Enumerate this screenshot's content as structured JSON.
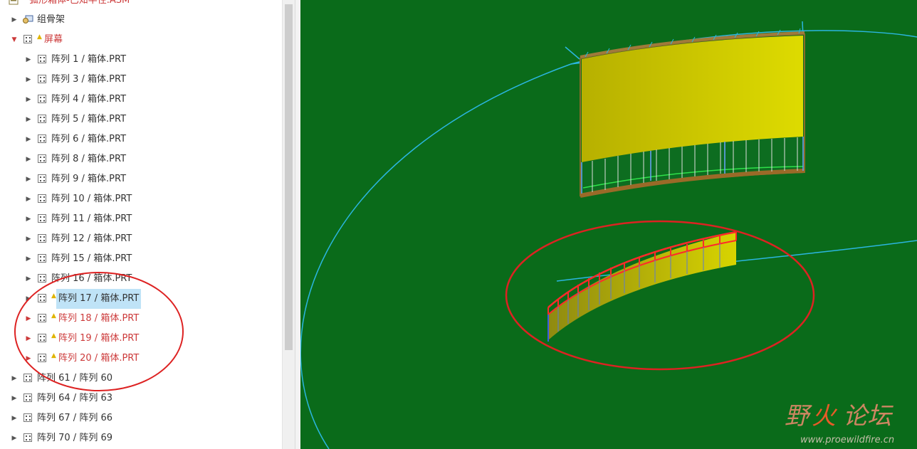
{
  "tree": {
    "top_label": "弧形箱体-已知半径.ASM",
    "skeleton_label": "组骨架",
    "screen_label": "屏幕",
    "items": [
      {
        "label": "阵列 1 / 箱体.PRT",
        "indent": 1
      },
      {
        "label": "阵列 3 / 箱体.PRT",
        "indent": 1
      },
      {
        "label": "阵列 4 / 箱体.PRT",
        "indent": 1
      },
      {
        "label": "阵列 5 / 箱体.PRT",
        "indent": 1
      },
      {
        "label": "阵列 6 / 箱体.PRT",
        "indent": 1
      },
      {
        "label": "阵列 8 / 箱体.PRT",
        "indent": 1
      },
      {
        "label": "阵列 9 / 箱体.PRT",
        "indent": 1
      },
      {
        "label": "阵列 10 / 箱体.PRT",
        "indent": 1
      },
      {
        "label": "阵列 11 / 箱体.PRT",
        "indent": 1
      },
      {
        "label": "阵列 12 / 箱体.PRT",
        "indent": 1
      },
      {
        "label": "阵列 15 / 箱体.PRT",
        "indent": 1
      },
      {
        "label": "阵列 16 / 箱体.PRT",
        "indent": 1
      },
      {
        "label": "阵列 17 / 箱体.PRT",
        "indent": 1
      },
      {
        "label": "阵列 18 / 箱体.PRT",
        "indent": 1
      },
      {
        "label": "阵列 19 / 箱体.PRT",
        "indent": 1
      },
      {
        "label": "阵列 20 / 箱体.PRT",
        "indent": 1
      },
      {
        "label": "阵列 61 / 阵列 60",
        "indent": 0
      },
      {
        "label": "阵列 64 / 阵列 63",
        "indent": 0
      },
      {
        "label": "阵列 67 / 阵列 66",
        "indent": 0
      },
      {
        "label": "阵列 70 / 阵列 69",
        "indent": 0
      }
    ]
  },
  "watermark": {
    "title_1": "野",
    "title_2": "火",
    "title_3": "论坛",
    "url": "www.proewildfire.cn"
  },
  "colors": {
    "viewport_bg": "#0a6b1a",
    "annotation_red": "#d22222",
    "datum_cyan": "#2bb6e0",
    "panel_yellow": "#d7d400",
    "warning_red_text": "#cc3a3a"
  }
}
